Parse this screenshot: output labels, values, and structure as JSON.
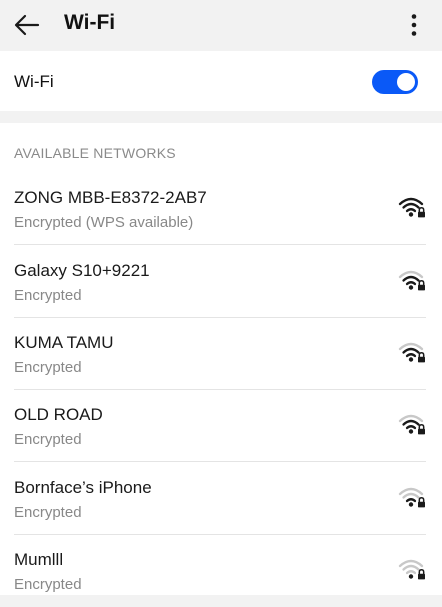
{
  "app_bar": {
    "title": "Wi-Fi",
    "back_icon": "arrow-left-icon",
    "more_icon": "more-vertical-icon"
  },
  "wifi_toggle": {
    "label": "Wi-Fi",
    "enabled": true,
    "accent_color": "#0a59f7"
  },
  "available_networks": {
    "header": "AVAILABLE NETWORKS",
    "items": [
      {
        "name": "ZONG MBB-E8372-2AB7",
        "status": "Encrypted (WPS available)",
        "signal_icon": "wifi-locked-icon",
        "signal_bars": 4
      },
      {
        "name": "Galaxy S10+9221",
        "status": "Encrypted",
        "signal_icon": "wifi-locked-icon",
        "signal_bars": 3
      },
      {
        "name": "KUMA TAMU",
        "status": "Encrypted",
        "signal_icon": "wifi-locked-icon",
        "signal_bars": 3
      },
      {
        "name": "OLD ROAD",
        "status": "Encrypted",
        "signal_icon": "wifi-locked-icon",
        "signal_bars": 3
      },
      {
        "name": "Bornface’s iPhone",
        "status": "Encrypted",
        "signal_icon": "wifi-locked-icon",
        "signal_bars": 2
      },
      {
        "name": "Mumlll",
        "status": "Encrypted",
        "signal_icon": "wifi-locked-icon",
        "signal_bars": 1
      }
    ]
  }
}
